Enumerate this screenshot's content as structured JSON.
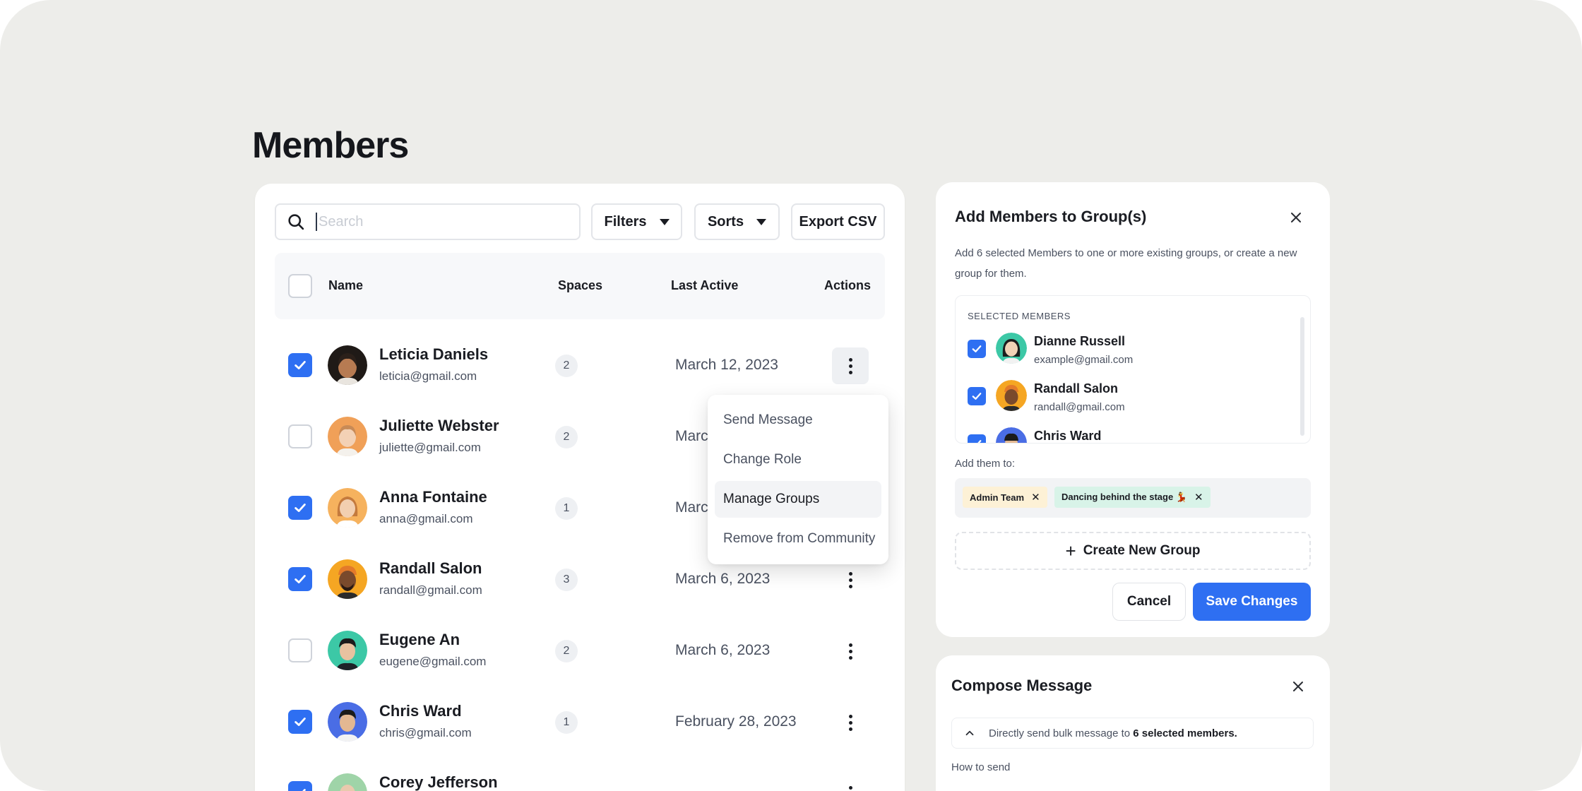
{
  "page": {
    "title": "Members"
  },
  "toolbar": {
    "search_placeholder": "Search",
    "filters_label": "Filters",
    "sorts_label": "Sorts",
    "export_label": "Export CSV"
  },
  "table": {
    "columns": {
      "name": "Name",
      "spaces": "Spaces",
      "last_active": "Last Active",
      "actions": "Actions"
    },
    "rows": [
      {
        "name": "Leticia Daniels",
        "email": "leticia@gmail.com",
        "spaces": "2",
        "last_active": "March 12, 2023",
        "checked": true
      },
      {
        "name": "Juliette Webster",
        "email": "juliette@gmail.com",
        "spaces": "2",
        "last_active": "March",
        "checked": false
      },
      {
        "name": "Anna Fontaine",
        "email": "anna@gmail.com",
        "spaces": "1",
        "last_active": "March",
        "checked": true
      },
      {
        "name": "Randall Salon",
        "email": "randall@gmail.com",
        "spaces": "3",
        "last_active": "March 6, 2023",
        "checked": true
      },
      {
        "name": "Eugene An",
        "email": "eugene@gmail.com",
        "spaces": "2",
        "last_active": "March 6, 2023",
        "checked": false
      },
      {
        "name": "Chris Ward",
        "email": "chris@gmail.com",
        "spaces": "1",
        "last_active": "February 28, 2023",
        "checked": true
      },
      {
        "name": "Corey Jefferson",
        "email": "",
        "spaces": "",
        "last_active": "",
        "checked": true
      }
    ]
  },
  "row_menu": {
    "items": [
      "Send Message",
      "Change Role",
      "Manage Groups",
      "Remove from Community"
    ],
    "highlighted": "Manage Groups"
  },
  "group_panel": {
    "title": "Add Members to Group(s)",
    "description": "Add 6 selected Members to one or more existing groups, or create a new group for them.",
    "selected_label": "SELECTED MEMBERS",
    "selected": [
      {
        "name": "Dianne Russell",
        "email": "example@gmail.com"
      },
      {
        "name": "Randall Salon",
        "email": "randall@gmail.com"
      },
      {
        "name": "Chris Ward",
        "email": ""
      }
    ],
    "add_label": "Add them to:",
    "tags": [
      {
        "label": "Admin Team",
        "color": "#fdf1d6"
      },
      {
        "label": "Dancing behind the stage 💃",
        "color": "#d8f3e8"
      }
    ],
    "create_label": "Create New Group",
    "cancel_label": "Cancel",
    "save_label": "Save Changes"
  },
  "compose_panel": {
    "title": "Compose Message",
    "banner_prefix": "Directly send bulk message to",
    "banner_strong": "6 selected members.",
    "how_label": "How to send"
  },
  "colors": {
    "accent": "#2e6ff2",
    "background": "#ededea",
    "card": "#ffffff"
  }
}
